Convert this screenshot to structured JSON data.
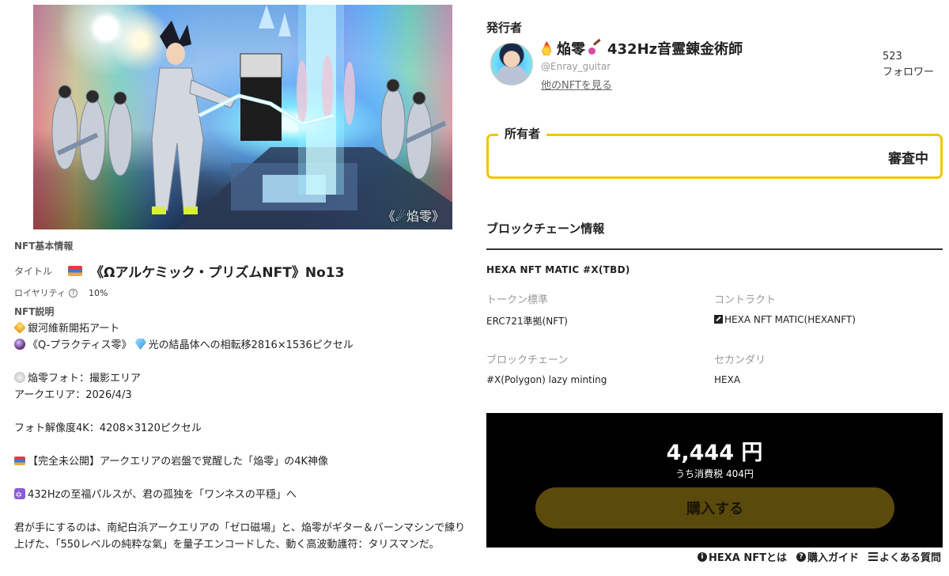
{
  "artwork": {
    "watermark": "《☄焰零》",
    "colors": {
      "lightning": "#7fe8ff",
      "suit": "#c8ced8",
      "rainbow": "#ff6a6a"
    }
  },
  "nft_info": {
    "section_label": "NFT基本情報",
    "title_label": "タイトル",
    "title": "《Ωアルケミック・プリズムNFT》No13",
    "royalty_label": "ロイヤリティ",
    "royalty_value": "10%",
    "description_label": "NFT説明",
    "description": {
      "l1": "銀河維新開拓アート",
      "l2a": "《Q-プラクティス零》",
      "l2b": "光の結晶体への相転移2816×1536ピクセル",
      "l3": "焔零フォト：撮影エリア",
      "l4": "アークエリア：2026/4/3",
      "l5": "フォト解像度4K：4208×3120ピクセル",
      "l6": "【完全未公開】アークエリアの岩盤で覚醒した「焔零」の4K神像",
      "l7": "432Hzの至福パルスが、君の孤独を「ワンネスの平穏」へ",
      "l8": "君が手にするのは、南紀白浜アークエリアの「ゼロ磁場」と、焔零がギター＆バーンマシンで練り上げた、「550レベルの純粋な氣」を量子エンコードした、動く高波動護符：タリスマンだ。"
    }
  },
  "publisher": {
    "heading": "発行者",
    "name": "焔零",
    "name_suffix": "432Hz音霊錬金術師",
    "handle": "@Enray_guitar",
    "other_link": "他のNFTを見る",
    "followers_count": "523",
    "followers_label": "フォロワー"
  },
  "owner": {
    "label": "所有者",
    "status": "審査中",
    "accent": "#f2c500"
  },
  "blockchain": {
    "heading": "ブロックチェーン情報",
    "token_name": "HEXA NFT MATIC #X(TBD)",
    "token_standard_label": "トークン標準",
    "token_standard_value": "ERC721準拠(NFT)",
    "contract_label": "コントラクト",
    "contract_value": "HEXA NFT MATIC(HEXANFT)",
    "chain_label": "ブロックチェーン",
    "chain_value": "#X(Polygon) lazy minting",
    "secondary_label": "セカンダリ",
    "secondary_value": "HEXA"
  },
  "purchase": {
    "price": "4,444 円",
    "tax": "うち消費税 404円",
    "buy_label": "購入する",
    "button_color": "#5a4a0c"
  },
  "footer": {
    "about": "HEXA NFTとは",
    "guide": "購入ガイド",
    "faq": "よくある質問"
  }
}
